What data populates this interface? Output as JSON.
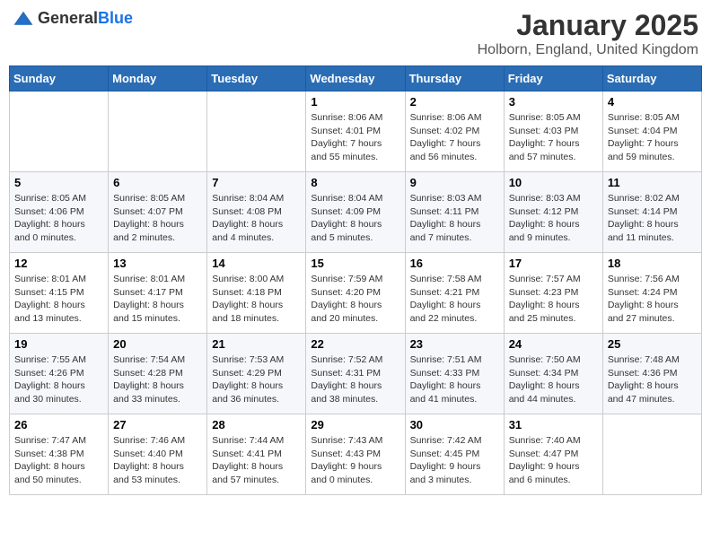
{
  "header": {
    "logo_general": "General",
    "logo_blue": "Blue",
    "month": "January 2025",
    "location": "Holborn, England, United Kingdom"
  },
  "weekdays": [
    "Sunday",
    "Monday",
    "Tuesday",
    "Wednesday",
    "Thursday",
    "Friday",
    "Saturday"
  ],
  "weeks": [
    [
      {
        "day": "",
        "info": ""
      },
      {
        "day": "",
        "info": ""
      },
      {
        "day": "",
        "info": ""
      },
      {
        "day": "1",
        "info": "Sunrise: 8:06 AM\nSunset: 4:01 PM\nDaylight: 7 hours\nand 55 minutes."
      },
      {
        "day": "2",
        "info": "Sunrise: 8:06 AM\nSunset: 4:02 PM\nDaylight: 7 hours\nand 56 minutes."
      },
      {
        "day": "3",
        "info": "Sunrise: 8:05 AM\nSunset: 4:03 PM\nDaylight: 7 hours\nand 57 minutes."
      },
      {
        "day": "4",
        "info": "Sunrise: 8:05 AM\nSunset: 4:04 PM\nDaylight: 7 hours\nand 59 minutes."
      }
    ],
    [
      {
        "day": "5",
        "info": "Sunrise: 8:05 AM\nSunset: 4:06 PM\nDaylight: 8 hours\nand 0 minutes."
      },
      {
        "day": "6",
        "info": "Sunrise: 8:05 AM\nSunset: 4:07 PM\nDaylight: 8 hours\nand 2 minutes."
      },
      {
        "day": "7",
        "info": "Sunrise: 8:04 AM\nSunset: 4:08 PM\nDaylight: 8 hours\nand 4 minutes."
      },
      {
        "day": "8",
        "info": "Sunrise: 8:04 AM\nSunset: 4:09 PM\nDaylight: 8 hours\nand 5 minutes."
      },
      {
        "day": "9",
        "info": "Sunrise: 8:03 AM\nSunset: 4:11 PM\nDaylight: 8 hours\nand 7 minutes."
      },
      {
        "day": "10",
        "info": "Sunrise: 8:03 AM\nSunset: 4:12 PM\nDaylight: 8 hours\nand 9 minutes."
      },
      {
        "day": "11",
        "info": "Sunrise: 8:02 AM\nSunset: 4:14 PM\nDaylight: 8 hours\nand 11 minutes."
      }
    ],
    [
      {
        "day": "12",
        "info": "Sunrise: 8:01 AM\nSunset: 4:15 PM\nDaylight: 8 hours\nand 13 minutes."
      },
      {
        "day": "13",
        "info": "Sunrise: 8:01 AM\nSunset: 4:17 PM\nDaylight: 8 hours\nand 15 minutes."
      },
      {
        "day": "14",
        "info": "Sunrise: 8:00 AM\nSunset: 4:18 PM\nDaylight: 8 hours\nand 18 minutes."
      },
      {
        "day": "15",
        "info": "Sunrise: 7:59 AM\nSunset: 4:20 PM\nDaylight: 8 hours\nand 20 minutes."
      },
      {
        "day": "16",
        "info": "Sunrise: 7:58 AM\nSunset: 4:21 PM\nDaylight: 8 hours\nand 22 minutes."
      },
      {
        "day": "17",
        "info": "Sunrise: 7:57 AM\nSunset: 4:23 PM\nDaylight: 8 hours\nand 25 minutes."
      },
      {
        "day": "18",
        "info": "Sunrise: 7:56 AM\nSunset: 4:24 PM\nDaylight: 8 hours\nand 27 minutes."
      }
    ],
    [
      {
        "day": "19",
        "info": "Sunrise: 7:55 AM\nSunset: 4:26 PM\nDaylight: 8 hours\nand 30 minutes."
      },
      {
        "day": "20",
        "info": "Sunrise: 7:54 AM\nSunset: 4:28 PM\nDaylight: 8 hours\nand 33 minutes."
      },
      {
        "day": "21",
        "info": "Sunrise: 7:53 AM\nSunset: 4:29 PM\nDaylight: 8 hours\nand 36 minutes."
      },
      {
        "day": "22",
        "info": "Sunrise: 7:52 AM\nSunset: 4:31 PM\nDaylight: 8 hours\nand 38 minutes."
      },
      {
        "day": "23",
        "info": "Sunrise: 7:51 AM\nSunset: 4:33 PM\nDaylight: 8 hours\nand 41 minutes."
      },
      {
        "day": "24",
        "info": "Sunrise: 7:50 AM\nSunset: 4:34 PM\nDaylight: 8 hours\nand 44 minutes."
      },
      {
        "day": "25",
        "info": "Sunrise: 7:48 AM\nSunset: 4:36 PM\nDaylight: 8 hours\nand 47 minutes."
      }
    ],
    [
      {
        "day": "26",
        "info": "Sunrise: 7:47 AM\nSunset: 4:38 PM\nDaylight: 8 hours\nand 50 minutes."
      },
      {
        "day": "27",
        "info": "Sunrise: 7:46 AM\nSunset: 4:40 PM\nDaylight: 8 hours\nand 53 minutes."
      },
      {
        "day": "28",
        "info": "Sunrise: 7:44 AM\nSunset: 4:41 PM\nDaylight: 8 hours\nand 57 minutes."
      },
      {
        "day": "29",
        "info": "Sunrise: 7:43 AM\nSunset: 4:43 PM\nDaylight: 9 hours\nand 0 minutes."
      },
      {
        "day": "30",
        "info": "Sunrise: 7:42 AM\nSunset: 4:45 PM\nDaylight: 9 hours\nand 3 minutes."
      },
      {
        "day": "31",
        "info": "Sunrise: 7:40 AM\nSunset: 4:47 PM\nDaylight: 9 hours\nand 6 minutes."
      },
      {
        "day": "",
        "info": ""
      }
    ]
  ]
}
